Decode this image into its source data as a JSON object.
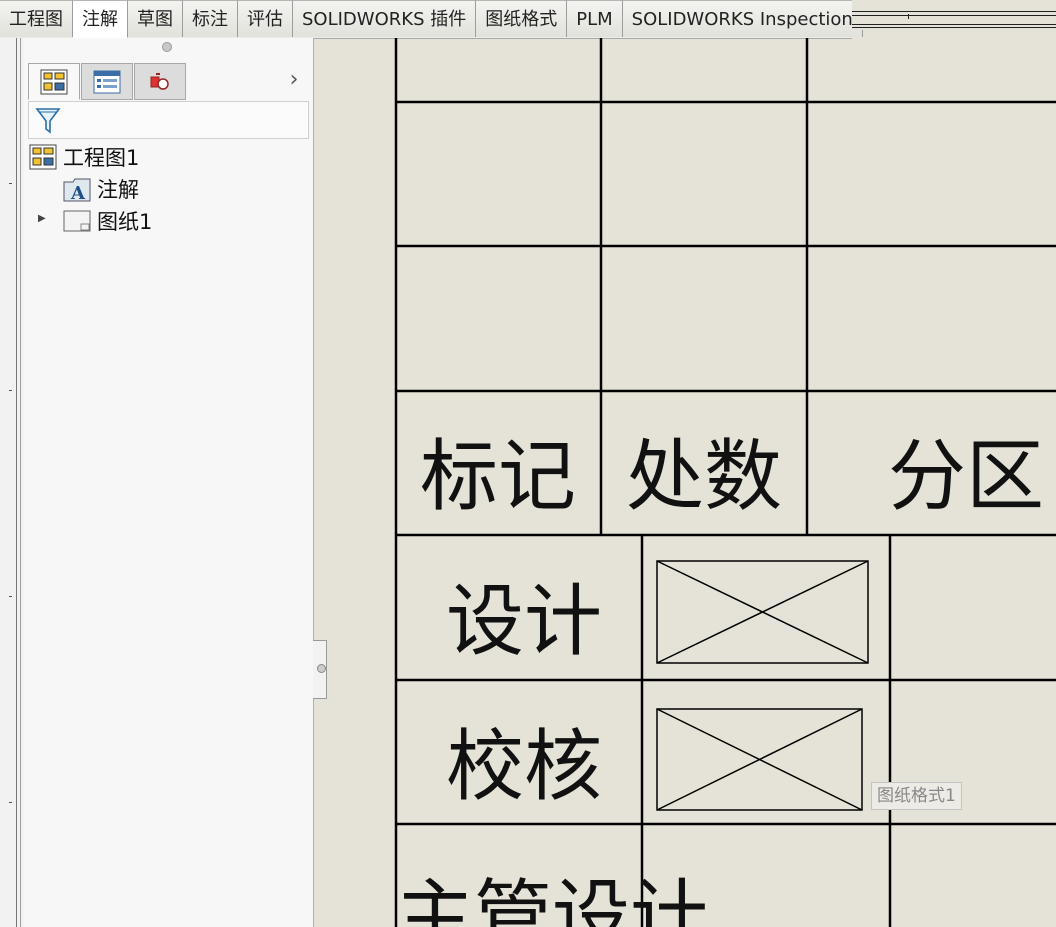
{
  "tabs": [
    "工程图",
    "注解",
    "草图",
    "标注",
    "评估",
    "SOLIDWORKS 插件",
    "图纸格式",
    "PLM",
    "SOLIDWORKS Inspection"
  ],
  "active_tab": "注解",
  "panel": {
    "tabs": [
      {
        "name": "featuremanager-tab",
        "icon": "feature-tree-icon"
      },
      {
        "name": "propertymanager-tab",
        "icon": "property-list-icon"
      },
      {
        "name": "configurationmanager-tab",
        "icon": "configuration-icon"
      }
    ],
    "tree": {
      "root": "工程图1",
      "children": [
        {
          "label": "注解",
          "icon": "annotations-folder-icon"
        },
        {
          "label": "图纸1",
          "icon": "sheet-icon",
          "collapsed": true
        }
      ]
    }
  },
  "title_block": {
    "row_labels": [
      "标记",
      "处数",
      "分区"
    ],
    "sign_rows": [
      "设计",
      "校核",
      "主管设计"
    ]
  },
  "tooltip": "图纸格式1",
  "colors": {
    "sheet_bg": "#e5e3d8",
    "line": "#000000"
  }
}
